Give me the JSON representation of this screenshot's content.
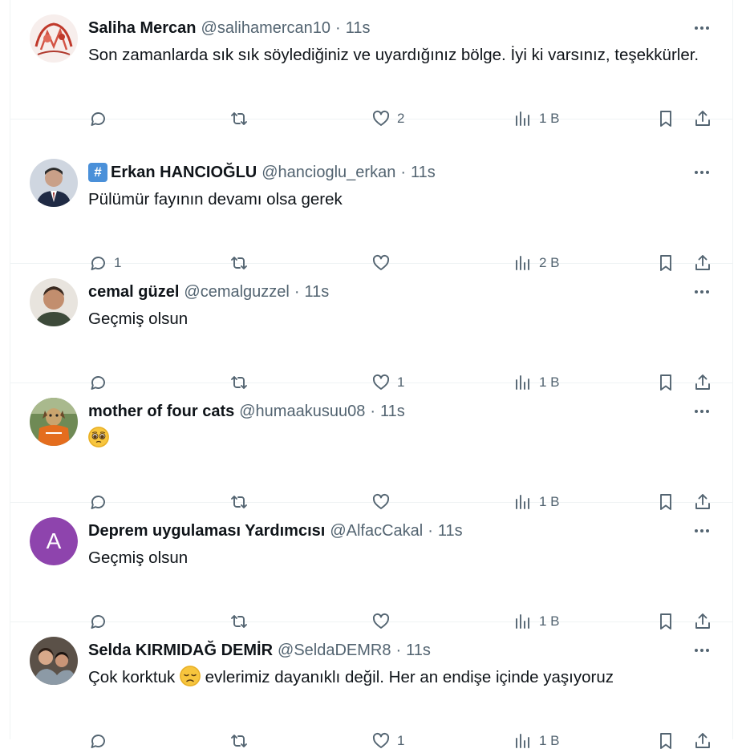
{
  "tweets": [
    {
      "name": "Saliha Mercan",
      "badge": "",
      "handle": "@salihamercan10",
      "separator": "·",
      "time": "11s",
      "text": "Son zamanlarda sık sık söylediğiniz ve uyardığınız bölge. İyi ki varsınız, teşekkürler.",
      "reply_count": "",
      "retweet_count": "",
      "like_count": "2",
      "views": "1 B",
      "avatar_type": "drawing"
    },
    {
      "name": "Erkan HANCIOĞLU",
      "badge": "#",
      "handle": "@hancioglu_erkan",
      "separator": "·",
      "time": "11s",
      "text": "Pülümür fayının devamı olsa gerek",
      "reply_count": "1",
      "retweet_count": "",
      "like_count": "",
      "views": "2 B",
      "avatar_type": "suit"
    },
    {
      "name": "cemal güzel",
      "badge": "",
      "handle": "@cemalguzzel",
      "separator": "·",
      "time": "11s",
      "text": "Geçmiş olsun",
      "reply_count": "",
      "retweet_count": "",
      "like_count": "1",
      "views": "1 B",
      "avatar_type": "portrait"
    },
    {
      "name": "mother of four cats",
      "badge": "",
      "handle": "@humaakusuu08",
      "separator": "·",
      "time": "11s",
      "text": "",
      "emoji": "pleading-face",
      "reply_count": "",
      "retweet_count": "",
      "like_count": "",
      "views": "1 B",
      "avatar_type": "dog"
    },
    {
      "name": "Deprem uygulaması Yardımcısı",
      "badge": "",
      "handle": "@AlfacCakal",
      "separator": "·",
      "time": "11s",
      "text": "Geçmiş olsun",
      "reply_count": "",
      "retweet_count": "",
      "like_count": "",
      "views": "1 B",
      "avatar_type": "letter",
      "avatar_letter": "A"
    },
    {
      "name": "Selda KIRMIDAĞ DEMİR",
      "badge": "",
      "handle": "@SeldaDEMR8",
      "separator": "·",
      "time": "11s",
      "text_before": "Çok korktuk",
      "emoji": "disappointed-face",
      "text_after": "evlerimiz dayanıklı değil. Her an endişe içinde yaşıyoruz",
      "reply_count": "",
      "retweet_count": "",
      "like_count": "1",
      "views": "1 B",
      "avatar_type": "group"
    }
  ],
  "icons": {
    "reply": "reply-icon",
    "retweet": "retweet-icon",
    "like": "heart-icon",
    "views": "views-chart-icon",
    "bookmark": "bookmark-icon",
    "share": "share-icon",
    "more": "more-icon"
  },
  "colors": {
    "text": "#0f1419",
    "secondary": "#536471",
    "border": "#eff3f4",
    "letter_avatar": "#8e44ad"
  }
}
